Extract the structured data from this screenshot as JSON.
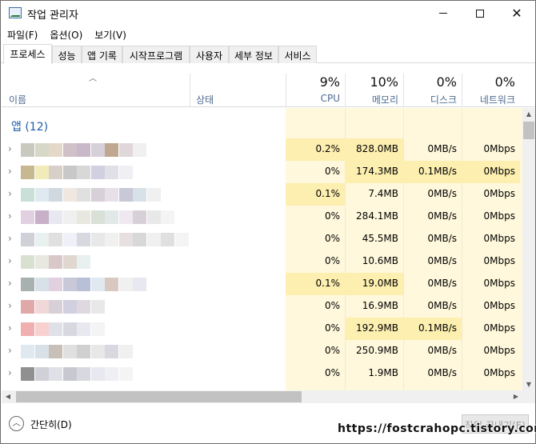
{
  "window": {
    "title": "작업 관리자"
  },
  "menu": [
    {
      "label": "파일(F)"
    },
    {
      "label": "옵션(O)"
    },
    {
      "label": "보기(V)"
    }
  ],
  "tabs": [
    {
      "label": "프로세스",
      "active": true
    },
    {
      "label": "성능"
    },
    {
      "label": "앱 기록"
    },
    {
      "label": "시작프로그램"
    },
    {
      "label": "사용자"
    },
    {
      "label": "세부 정보"
    },
    {
      "label": "서비스"
    }
  ],
  "header": {
    "name": "이름",
    "status": "상태",
    "cpu": {
      "pct": "9%",
      "label": "CPU"
    },
    "memory": {
      "pct": "10%",
      "label": "메모리"
    },
    "disk": {
      "pct": "0%",
      "label": "디스크"
    },
    "network": {
      "pct": "0%",
      "label": "네트워크"
    }
  },
  "group": {
    "label": "앱 (12)"
  },
  "rows": [
    {
      "cpu": "0.2%",
      "memory": "828.0MB",
      "disk": "0MB/s",
      "network": "0Mbps",
      "hl": [
        true,
        true,
        false,
        false
      ],
      "tiles": [
        "#c9c9c0",
        "#d8d8c8",
        "#e4d8c8",
        "#d0c0c8",
        "#c8b8c8",
        "#d8d0d8",
        "#c0a890",
        "#e0d8d8",
        "#f0f0f0"
      ]
    },
    {
      "cpu": "0%",
      "memory": "174.3MB",
      "disk": "0.1MB/s",
      "network": "0Mbps",
      "hl": [
        false,
        true,
        true,
        true
      ],
      "tiles": [
        "#c8b890",
        "#f0ebb8",
        "#d8d0c8",
        "#c8c8c8",
        "#d8d8d8",
        "#d0d0e0",
        "#e0e0e8",
        "#f0f0f4"
      ]
    },
    {
      "cpu": "0.1%",
      "memory": "7.4MB",
      "disk": "0MB/s",
      "network": "0Mbps",
      "hl": [
        true,
        false,
        false,
        false
      ],
      "tiles": [
        "#c8e0d8",
        "#e0e8f0",
        "#d0d8e0",
        "#f0e8e0",
        "#e0e0e0",
        "#d8d0d8",
        "#e8e0e8",
        "#c8c8d8",
        "#d8e0e8",
        "#f0f0f0"
      ]
    },
    {
      "cpu": "0%",
      "memory": "284.1MB",
      "disk": "0MB/s",
      "network": "0Mbps",
      "hl": [
        false,
        false,
        false,
        false
      ],
      "tiles": [
        "#e0d0e0",
        "#c8b0c8",
        "#e8e8f0",
        "#f0f0f0",
        "#e8e8e0",
        "#d8e0d8",
        "#e0e8e8",
        "#f0e8f0",
        "#d8d0d8",
        "#e8e8e8",
        "#f4f4f4"
      ]
    },
    {
      "cpu": "0%",
      "memory": "45.5MB",
      "disk": "0MB/s",
      "network": "0Mbps",
      "hl": [
        false,
        false,
        false,
        false
      ],
      "tiles": [
        "#d0d0d8",
        "#e8f0f0",
        "#e0e0e0",
        "#f0f0f8",
        "#d8d8e0",
        "#e8e8e8",
        "#f0f0f0",
        "#e8e0e0",
        "#d8d8d8",
        "#f0f0f0",
        "#e0e0e0",
        "#f4f4f4"
      ]
    },
    {
      "cpu": "0%",
      "memory": "10.6MB",
      "disk": "0MB/s",
      "network": "0Mbps",
      "hl": [
        false,
        false,
        false,
        false
      ],
      "tiles": [
        "#d8e0d0",
        "#e8e8e0",
        "#d8c8c8",
        "#e0d8d0",
        "#e8f0f0"
      ]
    },
    {
      "cpu": "0.1%",
      "memory": "19.0MB",
      "disk": "0MB/s",
      "network": "0Mbps",
      "hl": [
        true,
        true,
        false,
        false
      ],
      "tiles": [
        "#a8b0b0",
        "#d8e0e8",
        "#e0d0e0",
        "#c8c8d8",
        "#b8c0d8",
        "#e0e8f0",
        "#d8c8c0",
        "#f0f0f0",
        "#e8e8f0"
      ]
    },
    {
      "cpu": "0%",
      "memory": "16.9MB",
      "disk": "0MB/s",
      "network": "0Mbps",
      "hl": [
        false,
        false,
        false,
        false
      ],
      "tiles": [
        "#e0a8a8",
        "#f0d8d8",
        "#d8d0d8",
        "#d0d0e0",
        "#e0d8e0",
        "#e8e8e8"
      ]
    },
    {
      "cpu": "0%",
      "memory": "192.9MB",
      "disk": "0.1MB/s",
      "network": "0Mbps",
      "hl": [
        false,
        true,
        true,
        false
      ],
      "tiles": [
        "#f0b0b0",
        "#f8d0d0",
        "#e0e0e8",
        "#d8d8e0",
        "#e8e8f0",
        "#f4f4f4"
      ]
    },
    {
      "cpu": "0%",
      "memory": "250.9MB",
      "disk": "0MB/s",
      "network": "0Mbps",
      "hl": [
        false,
        false,
        false,
        false
      ],
      "tiles": [
        "#e0e8f0",
        "#d8e0e8",
        "#c8c0b8",
        "#e0e0e0",
        "#d0d0d0",
        "#e8e8e8",
        "#d8d8e0",
        "#f0f0f0"
      ]
    },
    {
      "cpu": "0%",
      "memory": "1.9MB",
      "disk": "0MB/s",
      "network": "0Mbps",
      "hl": [
        false,
        false,
        false,
        false
      ],
      "tiles": [
        "#909090",
        "#d0d0d8",
        "#e0e0e8",
        "#c8c8d0",
        "#d8d8e0",
        "#e8e8f0",
        "#f0f0f4",
        "#f4f4f4"
      ]
    }
  ],
  "footer": {
    "fewer_details": "간단히(D)",
    "end_task": "작업 끝내기(E)",
    "watermark": "https://fostcrahopc.tistory.com"
  }
}
